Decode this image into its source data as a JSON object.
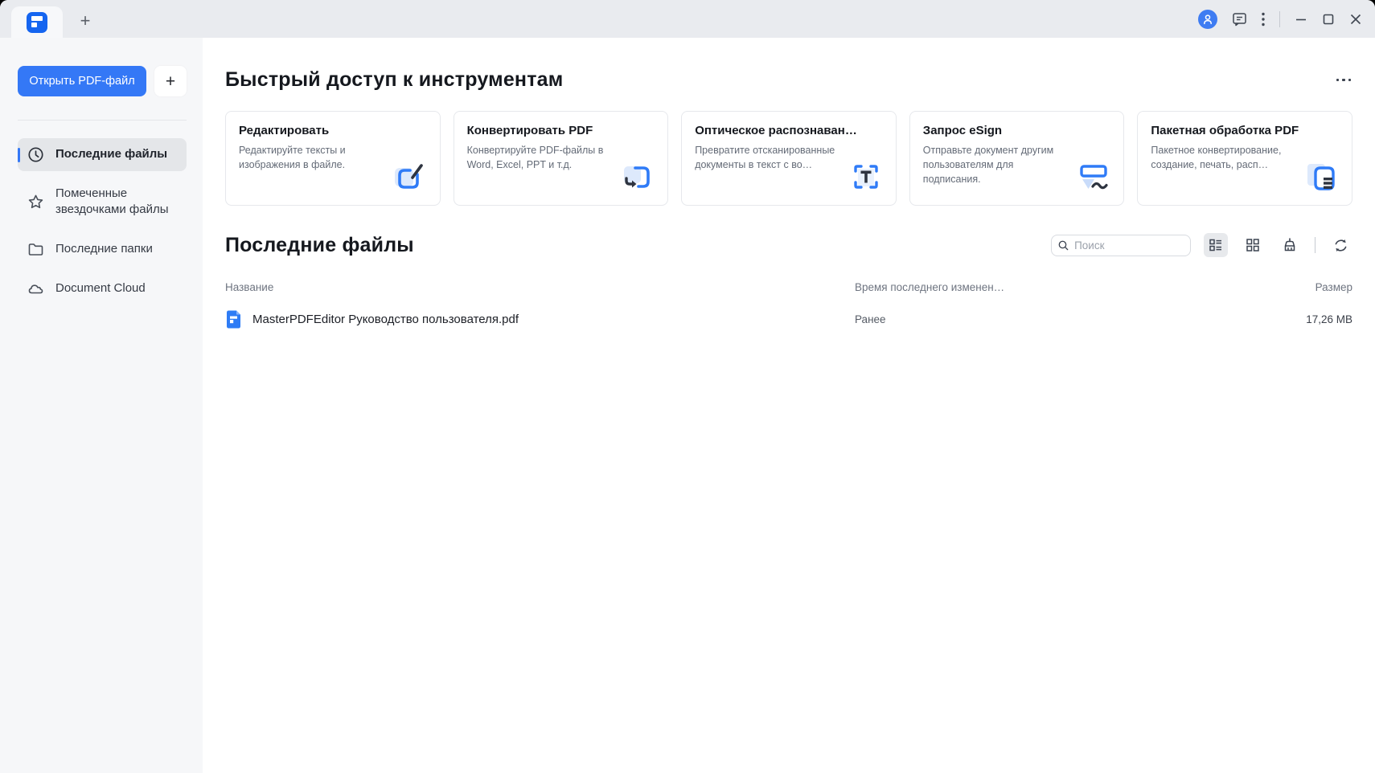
{
  "colors": {
    "accent": "#3478f6",
    "logo_blue": "#1565f0",
    "icon_dark": "#2e3440"
  },
  "icons": {
    "tabstrip": [
      "app-logo",
      "new-tab-plus",
      "user-avatar",
      "feedback-bubble",
      "kebab-menu",
      "minimize",
      "maximize",
      "close"
    ],
    "toolbar": [
      "search-magnifier",
      "list-view",
      "grid-view",
      "clean-broom",
      "refresh-sync"
    ],
    "sidebar": [
      "history-clock",
      "star",
      "folder",
      "cloud"
    ]
  },
  "tabstrip": {
    "new_tab_label": "+"
  },
  "sidebar": {
    "open_button": "Открыть PDF-файл",
    "add_button": "+",
    "items": [
      {
        "label": "Последние файлы",
        "active": true
      },
      {
        "label": "Помеченные звездочками файлы",
        "active": false
      },
      {
        "label": "Последние папки",
        "active": false
      },
      {
        "label": "Document Cloud",
        "active": false
      }
    ]
  },
  "quick_access": {
    "title": "Быстрый доступ к инструментам",
    "cards": [
      {
        "title": "Редактировать",
        "description": "Редактируйте тексты и изображения в файле."
      },
      {
        "title": "Конвертировать PDF",
        "description": "Конвертируйте PDF-файлы в Word, Excel, PPT и т.д."
      },
      {
        "title": "Оптическое распознаван…",
        "description": "Превратите отсканированные документы в текст с во…"
      },
      {
        "title": "Запрос eSign",
        "description": "Отправьте документ другим пользователям для подписания."
      },
      {
        "title": "Пакетная обработка PDF",
        "description": "Пакетное конвертирование, создание, печать, расп…"
      }
    ]
  },
  "recent_files": {
    "title": "Последние файлы",
    "search_placeholder": "Поиск",
    "columns": {
      "name": "Название",
      "modified": "Время последнего изменен…",
      "size": "Размер"
    },
    "rows": [
      {
        "name": "MasterPDFEditor Руководство пользователя.pdf",
        "modified": "Ранее",
        "size": "17,26 MB"
      }
    ]
  }
}
